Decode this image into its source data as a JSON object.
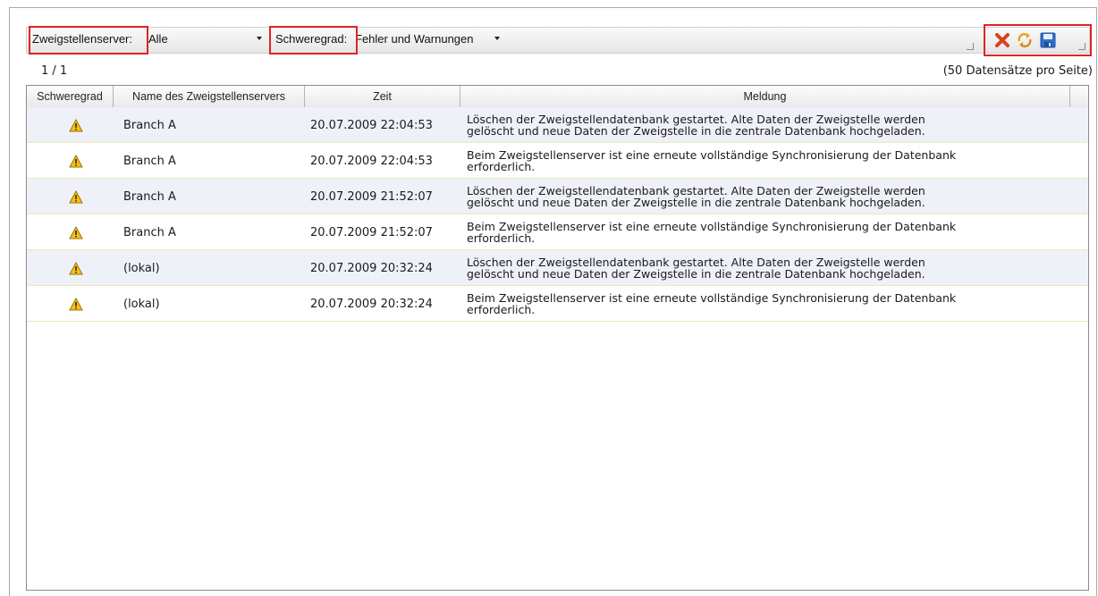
{
  "toolbar": {
    "branch_label": "Zweigstellenserver:",
    "branch_value": "Alle",
    "severity_label": "Schweregrad:",
    "severity_value": "Fehler und Warnungen"
  },
  "pager": {
    "page": "1 / 1",
    "per_page": "(50 Datensätze pro Seite)"
  },
  "columns": [
    "Schweregrad",
    "Name des Zweigstellenservers",
    "Zeit",
    "Meldung"
  ],
  "rows": [
    {
      "severity": "warning-icon",
      "server": "Branch A",
      "time": "20.07.2009 22:04:53",
      "msg1": "Löschen der Zweigstellendatenbank gestartet. Alte Daten der Zweigstelle werden",
      "msg2": "gelöscht und neue Daten der Zweigstelle in die zentrale Datenbank hochgeladen."
    },
    {
      "severity": "warning-icon",
      "server": "Branch A",
      "time": "20.07.2009 22:04:53",
      "msg1": "Beim Zweigstellenserver ist eine erneute vollständige Synchronisierung der Datenbank",
      "msg2": "erforderlich."
    },
    {
      "severity": "warning-icon",
      "server": "Branch A",
      "time": "20.07.2009 21:52:07",
      "msg1": "Löschen der Zweigstellendatenbank gestartet. Alte Daten der Zweigstelle werden",
      "msg2": "gelöscht und neue Daten der Zweigstelle in die zentrale Datenbank hochgeladen."
    },
    {
      "severity": "warning-icon",
      "server": "Branch A",
      "time": "20.07.2009 21:52:07",
      "msg1": "Beim Zweigstellenserver ist eine erneute vollständige Synchronisierung der Datenbank",
      "msg2": "erforderlich."
    },
    {
      "severity": "warning-icon",
      "server": "(lokal)",
      "time": "20.07.2009 20:32:24",
      "msg1": "Löschen der Zweigstellendatenbank gestartet. Alte Daten der Zweigstelle werden",
      "msg2": "gelöscht und neue Daten der Zweigstelle in die zentrale Datenbank hochgeladen."
    },
    {
      "severity": "warning-icon",
      "server": "(lokal)",
      "time": "20.07.2009 20:32:24",
      "msg1": "Beim Zweigstellenserver ist eine erneute vollständige Synchronisierung der Datenbank",
      "msg2": "erforderlich."
    }
  ],
  "colors": {
    "highlight": "#e0222a",
    "row_alt": "#eef1f7",
    "warning": "#f2c21a"
  }
}
